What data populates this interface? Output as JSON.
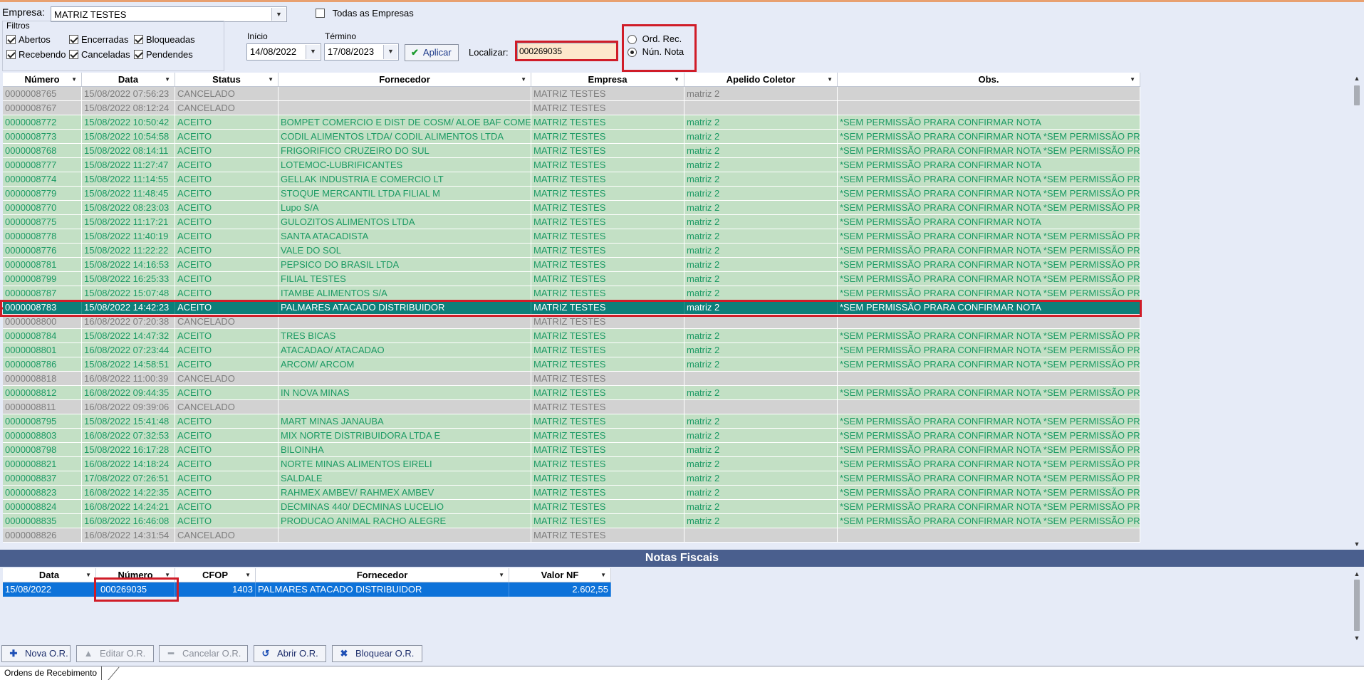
{
  "empresa": {
    "label": "Empresa:",
    "value": "MATRIZ TESTES"
  },
  "todas": {
    "label": "Todas as Empresas",
    "checked": false
  },
  "filtros": {
    "title": "Filtros",
    "items": [
      {
        "label": "Abertos",
        "checked": true
      },
      {
        "label": "Encerradas",
        "checked": true
      },
      {
        "label": "Bloqueadas",
        "checked": true
      },
      {
        "label": "Recebendo",
        "checked": true
      },
      {
        "label": "Canceladas",
        "checked": true
      },
      {
        "label": "Pendendes",
        "checked": true
      }
    ]
  },
  "inicio": {
    "label": "Início",
    "value": "14/08/2022"
  },
  "termino": {
    "label": "Término",
    "value": "17/08/2023"
  },
  "apply_label": "Aplicar",
  "localizar": {
    "label": "Localizar:",
    "value": "000269035"
  },
  "ordem": {
    "options": [
      {
        "label": "Ord. Rec.",
        "selected": false
      },
      {
        "label": "Nún. Nota",
        "selected": true
      }
    ]
  },
  "grid": {
    "columns": [
      "Número",
      "Data",
      "Status",
      "Fornecedor",
      "Empresa",
      "Apelido Coletor",
      "Obs."
    ],
    "rows": [
      [
        "0000008765",
        "15/08/2022 07:56:23",
        "CANCELADO",
        "",
        "MATRIZ TESTES",
        "matriz 2",
        ""
      ],
      [
        "0000008767",
        "15/08/2022 08:12:24",
        "CANCELADO",
        "",
        "MATRIZ TESTES",
        "",
        ""
      ],
      [
        "0000008772",
        "15/08/2022 10:50:42",
        "ACEITO",
        "BOMPET COMERCIO E DIST DE COSM/ ALOE BAF COME",
        "MATRIZ TESTES",
        "matriz 2",
        "*SEM PERMISSÃO PRARA CONFIRMAR NOTA"
      ],
      [
        "0000008773",
        "15/08/2022 10:54:58",
        "ACEITO",
        "CODIL ALIMENTOS LTDA/ CODIL ALIMENTOS LTDA",
        "MATRIZ TESTES",
        "matriz 2",
        "*SEM PERMISSÃO PRARA CONFIRMAR NOTA *SEM PERMISSÃO PR"
      ],
      [
        "0000008768",
        "15/08/2022 08:14:11",
        "ACEITO",
        "FRIGORIFICO CRUZEIRO DO SUL",
        "MATRIZ TESTES",
        "matriz 2",
        "*SEM PERMISSÃO PRARA CONFIRMAR NOTA *SEM PERMISSÃO PR"
      ],
      [
        "0000008777",
        "15/08/2022 11:27:47",
        "ACEITO",
        "LOTEMOC-LUBRIFICANTES",
        "MATRIZ TESTES",
        "matriz 2",
        "*SEM PERMISSÃO PRARA CONFIRMAR NOTA"
      ],
      [
        "0000008774",
        "15/08/2022 11:14:55",
        "ACEITO",
        "GELLAK INDUSTRIA E COMERCIO LT",
        "MATRIZ TESTES",
        "matriz 2",
        "*SEM PERMISSÃO PRARA CONFIRMAR NOTA *SEM PERMISSÃO PR"
      ],
      [
        "0000008779",
        "15/08/2022 11:48:45",
        "ACEITO",
        "STOQUE MERCANTIL LTDA FILIAL M",
        "MATRIZ TESTES",
        "matriz 2",
        "*SEM PERMISSÃO PRARA CONFIRMAR NOTA *SEM PERMISSÃO PR"
      ],
      [
        "0000008770",
        "15/08/2022 08:23:03",
        "ACEITO",
        "Lupo S/A",
        "MATRIZ TESTES",
        "matriz 2",
        "*SEM PERMISSÃO PRARA CONFIRMAR NOTA *SEM PERMISSÃO PR"
      ],
      [
        "0000008775",
        "15/08/2022 11:17:21",
        "ACEITO",
        "GULOZITOS ALIMENTOS LTDA",
        "MATRIZ TESTES",
        "matriz 2",
        "*SEM PERMISSÃO PRARA CONFIRMAR NOTA"
      ],
      [
        "0000008778",
        "15/08/2022 11:40:19",
        "ACEITO",
        "SANTA ATACADISTA",
        "MATRIZ TESTES",
        "matriz 2",
        "*SEM PERMISSÃO PRARA CONFIRMAR NOTA *SEM PERMISSÃO PR"
      ],
      [
        "0000008776",
        "15/08/2022 11:22:22",
        "ACEITO",
        "VALE DO SOL",
        "MATRIZ TESTES",
        "matriz 2",
        "*SEM PERMISSÃO PRARA CONFIRMAR NOTA *SEM PERMISSÃO PR"
      ],
      [
        "0000008781",
        "15/08/2022 14:16:53",
        "ACEITO",
        "PEPSICO DO BRASIL LTDA",
        "MATRIZ TESTES",
        "matriz 2",
        "*SEM PERMISSÃO PRARA CONFIRMAR NOTA *SEM PERMISSÃO PR"
      ],
      [
        "0000008799",
        "15/08/2022 16:25:33",
        "ACEITO",
        "FILIAL TESTES",
        "MATRIZ TESTES",
        "matriz 2",
        "*SEM PERMISSÃO PRARA CONFIRMAR NOTA *SEM PERMISSÃO PR"
      ],
      [
        "0000008787",
        "15/08/2022 15:07:48",
        "ACEITO",
        "ITAMBE ALIMENTOS S/A",
        "MATRIZ TESTES",
        "matriz 2",
        "*SEM PERMISSÃO PRARA CONFIRMAR NOTA *SEM PERMISSÃO PR"
      ],
      [
        "0000008783",
        "15/08/2022 14:42:23",
        "ACEITO",
        "PALMARES ATACADO DISTRIBUIDOR",
        "MATRIZ TESTES",
        "matriz 2",
        "*SEM PERMISSÃO PRARA CONFIRMAR NOTA"
      ],
      [
        "0000008800",
        "16/08/2022 07:20:38",
        "CANCELADO",
        "",
        "MATRIZ TESTES",
        "",
        ""
      ],
      [
        "0000008784",
        "15/08/2022 14:47:32",
        "ACEITO",
        "TRES BICAS",
        "MATRIZ TESTES",
        "matriz 2",
        "*SEM PERMISSÃO PRARA CONFIRMAR NOTA *SEM PERMISSÃO PR"
      ],
      [
        "0000008801",
        "16/08/2022 07:23:44",
        "ACEITO",
        "ATACADAO/ ATACADAO",
        "MATRIZ TESTES",
        "matriz 2",
        "*SEM PERMISSÃO PRARA CONFIRMAR NOTA *SEM PERMISSÃO PR"
      ],
      [
        "0000008786",
        "15/08/2022 14:58:51",
        "ACEITO",
        "ARCOM/ ARCOM",
        "MATRIZ TESTES",
        "matriz 2",
        "*SEM PERMISSÃO PRARA CONFIRMAR NOTA *SEM PERMISSÃO PR"
      ],
      [
        "0000008818",
        "16/08/2022 11:00:39",
        "CANCELADO",
        "",
        "MATRIZ TESTES",
        "",
        ""
      ],
      [
        "0000008812",
        "16/08/2022 09:44:35",
        "ACEITO",
        "IN NOVA MINAS",
        "MATRIZ TESTES",
        "matriz 2",
        "*SEM PERMISSÃO PRARA CONFIRMAR NOTA *SEM PERMISSÃO PR"
      ],
      [
        "0000008811",
        "16/08/2022 09:39:06",
        "CANCELADO",
        "",
        "MATRIZ TESTES",
        "",
        ""
      ],
      [
        "0000008795",
        "15/08/2022 15:41:48",
        "ACEITO",
        "MART MINAS JANAUBA",
        "MATRIZ TESTES",
        "matriz 2",
        "*SEM PERMISSÃO PRARA CONFIRMAR NOTA *SEM PERMISSÃO PR"
      ],
      [
        "0000008803",
        "16/08/2022 07:32:53",
        "ACEITO",
        "MIX NORTE DISTRIBUIDORA LTDA E",
        "MATRIZ TESTES",
        "matriz 2",
        "*SEM PERMISSÃO PRARA CONFIRMAR NOTA *SEM PERMISSÃO PR"
      ],
      [
        "0000008798",
        "15/08/2022 16:17:28",
        "ACEITO",
        "BILOINHA",
        "MATRIZ TESTES",
        "matriz 2",
        "*SEM PERMISSÃO PRARA CONFIRMAR NOTA *SEM PERMISSÃO PR"
      ],
      [
        "0000008821",
        "16/08/2022 14:18:24",
        "ACEITO",
        "NORTE MINAS ALIMENTOS EIRELI",
        "MATRIZ TESTES",
        "matriz 2",
        "*SEM PERMISSÃO PRARA CONFIRMAR NOTA *SEM PERMISSÃO PR"
      ],
      [
        "0000008837",
        "17/08/2022 07:26:51",
        "ACEITO",
        "SALDALE",
        "MATRIZ TESTES",
        "matriz 2",
        "*SEM PERMISSÃO PRARA CONFIRMAR NOTA *SEM PERMISSÃO PR"
      ],
      [
        "0000008823",
        "16/08/2022 14:22:35",
        "ACEITO",
        "RAHMEX AMBEV/ RAHMEX AMBEV",
        "MATRIZ TESTES",
        "matriz 2",
        "*SEM PERMISSÃO PRARA CONFIRMAR NOTA *SEM PERMISSÃO PR"
      ],
      [
        "0000008824",
        "16/08/2022 14:24:21",
        "ACEITO",
        "DECMINAS 440/ DECMINAS LUCELIO",
        "MATRIZ TESTES",
        "matriz 2",
        "*SEM PERMISSÃO PRARA CONFIRMAR NOTA *SEM PERMISSÃO PR"
      ],
      [
        "0000008835",
        "16/08/2022 16:46:08",
        "ACEITO",
        "PRODUCAO ANIMAL RACHO ALEGRE",
        "MATRIZ TESTES",
        "matriz 2",
        "*SEM PERMISSÃO PRARA CONFIRMAR NOTA *SEM PERMISSÃO PR"
      ],
      [
        "0000008826",
        "16/08/2022 14:31:54",
        "CANCELADO",
        "",
        "MATRIZ TESTES",
        "",
        ""
      ]
    ]
  },
  "notas": {
    "title": "Notas Fiscais",
    "columns": [
      "Data",
      "Número",
      "CFOP",
      "Fornecedor",
      "Valor NF"
    ],
    "rows": [
      [
        "15/08/2022",
        "000269035",
        "1403",
        "PALMARES ATACADO DISTRIBUIDOR",
        "2.602,55"
      ]
    ]
  },
  "buttons": {
    "nova": "Nova O.R.",
    "editar": "Editar O.R.",
    "cancelar": "Cancelar O.R.",
    "abrir": "Abrir O.R.",
    "bloquear": "Bloquear O.R."
  },
  "tab_label": "Ordens de Recebimento",
  "colors": {
    "cancelled_row": "#d2d2d2",
    "accepted_row": "#c3e0c5",
    "accepted_text": "#1c9a64",
    "selected_row": "#0d7f79",
    "highlight_border": "#d01c28",
    "section_bar": "#4a5f8e",
    "nf_selected": "#0d72d9"
  }
}
